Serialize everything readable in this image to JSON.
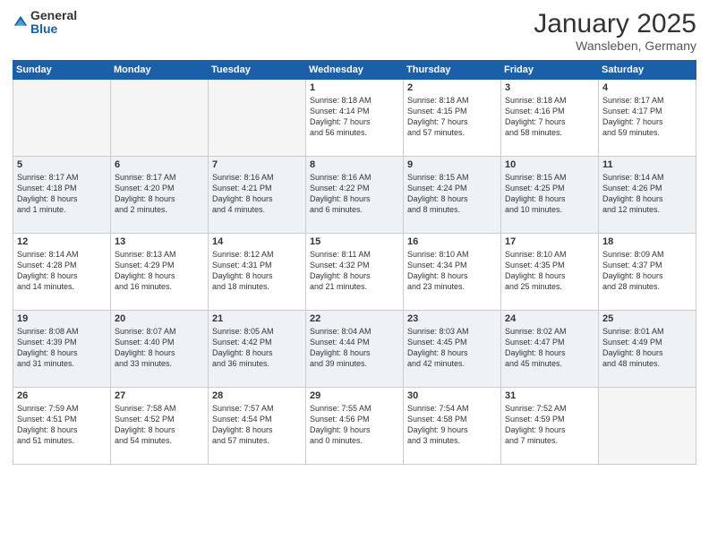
{
  "logo": {
    "general": "General",
    "blue": "Blue"
  },
  "title": "January 2025",
  "subtitle": "Wansleben, Germany",
  "days": [
    "Sunday",
    "Monday",
    "Tuesday",
    "Wednesday",
    "Thursday",
    "Friday",
    "Saturday"
  ],
  "weeks": [
    [
      {
        "day": "",
        "content": ""
      },
      {
        "day": "",
        "content": ""
      },
      {
        "day": "",
        "content": ""
      },
      {
        "day": "1",
        "content": "Sunrise: 8:18 AM\nSunset: 4:14 PM\nDaylight: 7 hours\nand 56 minutes."
      },
      {
        "day": "2",
        "content": "Sunrise: 8:18 AM\nSunset: 4:15 PM\nDaylight: 7 hours\nand 57 minutes."
      },
      {
        "day": "3",
        "content": "Sunrise: 8:18 AM\nSunset: 4:16 PM\nDaylight: 7 hours\nand 58 minutes."
      },
      {
        "day": "4",
        "content": "Sunrise: 8:17 AM\nSunset: 4:17 PM\nDaylight: 7 hours\nand 59 minutes."
      }
    ],
    [
      {
        "day": "5",
        "content": "Sunrise: 8:17 AM\nSunset: 4:18 PM\nDaylight: 8 hours\nand 1 minute."
      },
      {
        "day": "6",
        "content": "Sunrise: 8:17 AM\nSunset: 4:20 PM\nDaylight: 8 hours\nand 2 minutes."
      },
      {
        "day": "7",
        "content": "Sunrise: 8:16 AM\nSunset: 4:21 PM\nDaylight: 8 hours\nand 4 minutes."
      },
      {
        "day": "8",
        "content": "Sunrise: 8:16 AM\nSunset: 4:22 PM\nDaylight: 8 hours\nand 6 minutes."
      },
      {
        "day": "9",
        "content": "Sunrise: 8:15 AM\nSunset: 4:24 PM\nDaylight: 8 hours\nand 8 minutes."
      },
      {
        "day": "10",
        "content": "Sunrise: 8:15 AM\nSunset: 4:25 PM\nDaylight: 8 hours\nand 10 minutes."
      },
      {
        "day": "11",
        "content": "Sunrise: 8:14 AM\nSunset: 4:26 PM\nDaylight: 8 hours\nand 12 minutes."
      }
    ],
    [
      {
        "day": "12",
        "content": "Sunrise: 8:14 AM\nSunset: 4:28 PM\nDaylight: 8 hours\nand 14 minutes."
      },
      {
        "day": "13",
        "content": "Sunrise: 8:13 AM\nSunset: 4:29 PM\nDaylight: 8 hours\nand 16 minutes."
      },
      {
        "day": "14",
        "content": "Sunrise: 8:12 AM\nSunset: 4:31 PM\nDaylight: 8 hours\nand 18 minutes."
      },
      {
        "day": "15",
        "content": "Sunrise: 8:11 AM\nSunset: 4:32 PM\nDaylight: 8 hours\nand 21 minutes."
      },
      {
        "day": "16",
        "content": "Sunrise: 8:10 AM\nSunset: 4:34 PM\nDaylight: 8 hours\nand 23 minutes."
      },
      {
        "day": "17",
        "content": "Sunrise: 8:10 AM\nSunset: 4:35 PM\nDaylight: 8 hours\nand 25 minutes."
      },
      {
        "day": "18",
        "content": "Sunrise: 8:09 AM\nSunset: 4:37 PM\nDaylight: 8 hours\nand 28 minutes."
      }
    ],
    [
      {
        "day": "19",
        "content": "Sunrise: 8:08 AM\nSunset: 4:39 PM\nDaylight: 8 hours\nand 31 minutes."
      },
      {
        "day": "20",
        "content": "Sunrise: 8:07 AM\nSunset: 4:40 PM\nDaylight: 8 hours\nand 33 minutes."
      },
      {
        "day": "21",
        "content": "Sunrise: 8:05 AM\nSunset: 4:42 PM\nDaylight: 8 hours\nand 36 minutes."
      },
      {
        "day": "22",
        "content": "Sunrise: 8:04 AM\nSunset: 4:44 PM\nDaylight: 8 hours\nand 39 minutes."
      },
      {
        "day": "23",
        "content": "Sunrise: 8:03 AM\nSunset: 4:45 PM\nDaylight: 8 hours\nand 42 minutes."
      },
      {
        "day": "24",
        "content": "Sunrise: 8:02 AM\nSunset: 4:47 PM\nDaylight: 8 hours\nand 45 minutes."
      },
      {
        "day": "25",
        "content": "Sunrise: 8:01 AM\nSunset: 4:49 PM\nDaylight: 8 hours\nand 48 minutes."
      }
    ],
    [
      {
        "day": "26",
        "content": "Sunrise: 7:59 AM\nSunset: 4:51 PM\nDaylight: 8 hours\nand 51 minutes."
      },
      {
        "day": "27",
        "content": "Sunrise: 7:58 AM\nSunset: 4:52 PM\nDaylight: 8 hours\nand 54 minutes."
      },
      {
        "day": "28",
        "content": "Sunrise: 7:57 AM\nSunset: 4:54 PM\nDaylight: 8 hours\nand 57 minutes."
      },
      {
        "day": "29",
        "content": "Sunrise: 7:55 AM\nSunset: 4:56 PM\nDaylight: 9 hours\nand 0 minutes."
      },
      {
        "day": "30",
        "content": "Sunrise: 7:54 AM\nSunset: 4:58 PM\nDaylight: 9 hours\nand 3 minutes."
      },
      {
        "day": "31",
        "content": "Sunrise: 7:52 AM\nSunset: 4:59 PM\nDaylight: 9 hours\nand 7 minutes."
      },
      {
        "day": "",
        "content": ""
      }
    ]
  ]
}
